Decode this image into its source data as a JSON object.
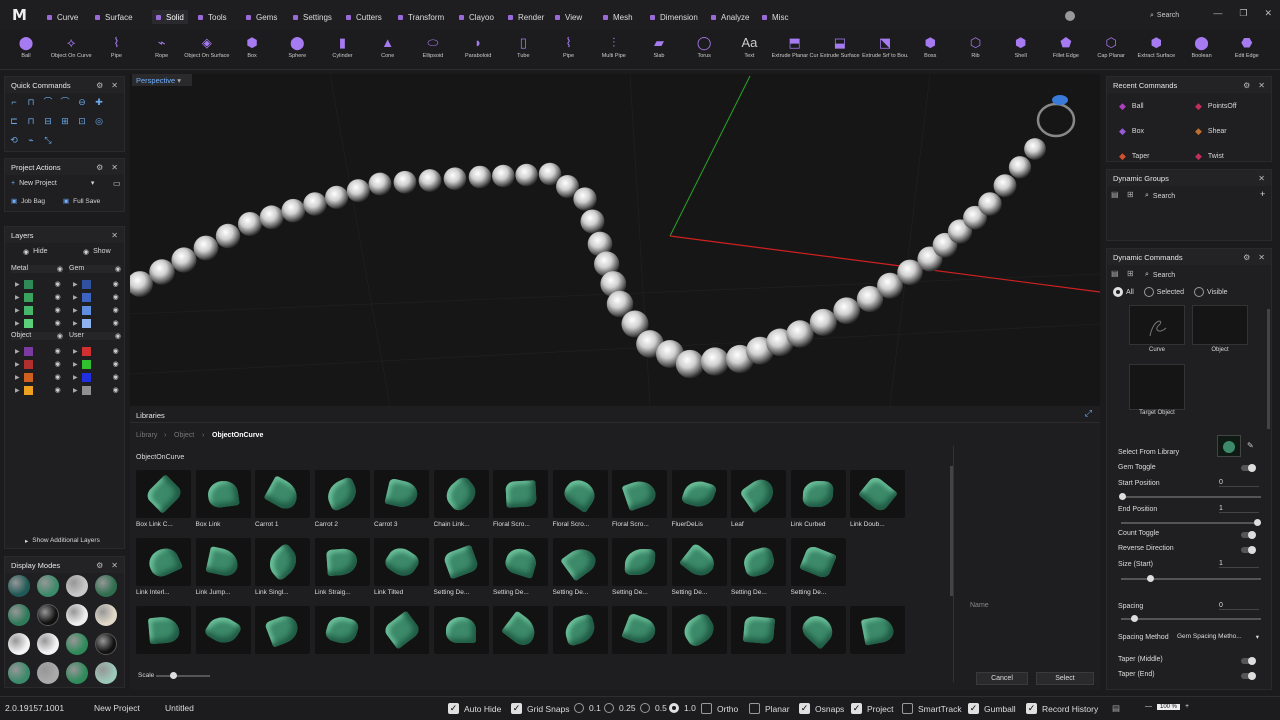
{
  "menu": {
    "tabs": [
      "Curve",
      "Surface",
      "Solid",
      "Tools",
      "Gems",
      "Settings",
      "Cutters",
      "Transform",
      "Clayoo",
      "Render",
      "View",
      "Mesh",
      "Dimension",
      "Analyze",
      "Misc"
    ],
    "active": "Solid",
    "accent": "#9a6ad8",
    "profile_name": "",
    "search_label": "Search"
  },
  "toolbar": {
    "items": [
      "Ball",
      "Object On Curve",
      "Pipe",
      "Rope",
      "Object On Surface",
      "Box",
      "Sphere",
      "Cylinder",
      "Cone",
      "Ellipsoid",
      "Paraboloid",
      "Tube",
      "Pipe",
      "Multi Pipe",
      "Slab",
      "Torus",
      "Text",
      "Extrude Planar Curve",
      "Extrude Surface",
      "Extrude Srf to Bou...",
      "Boss",
      "Rib",
      "Shell",
      "Fillet Edge",
      "Cap Planar",
      "Extract Surface",
      "Boolean",
      "Edit Edge"
    ],
    "text_icon": "Aa"
  },
  "quick_commands": {
    "title": "Quick Commands"
  },
  "project_actions": {
    "title": "Project Actions",
    "new_project": "New Project",
    "job_bag": "Job Bag",
    "full_save": "Full Save"
  },
  "layers": {
    "title": "Layers",
    "hide": "Hide",
    "show": "Show",
    "groups": [
      "Metal",
      "Gem",
      "Object",
      "User"
    ],
    "metal_colors": [
      "#2e8b57",
      "#3aa35e",
      "#46b86a",
      "#5ccf7a"
    ],
    "gem_colors": [
      "#3050a0",
      "#3c64c0",
      "#5f8de0",
      "#8fb3f0"
    ],
    "object_colors": [
      "#7a3aa0",
      "#b03030",
      "#d06020",
      "#f0a020"
    ],
    "user_colors": [
      "#d03030",
      "#30c030",
      "#2030e0",
      "#909090"
    ],
    "show_additional": "Show Additional Layers"
  },
  "display_modes": {
    "title": "Display Modes"
  },
  "viewport": {
    "label": "Perspective"
  },
  "libraries": {
    "title": "Libraries",
    "breadcrumb": [
      "Library",
      "Object",
      "ObjectOnCurve"
    ],
    "section": "ObjectOnCurve",
    "items_row1": [
      "Box Link C...",
      "Box Link",
      "Carrot 1",
      "Carrot 2",
      "Carrot 3",
      "Chain Link...",
      "Floral Scro...",
      "Floral Scro...",
      "Floral Scro...",
      "FluerDeLis",
      "Leaf",
      "Link Curbed",
      "Link Doub..."
    ],
    "items_row2": [
      "Link Interl...",
      "Link Jump...",
      "Link Singl...",
      "Link Straig...",
      "Link Tilted",
      "Setting De...",
      "Setting De...",
      "Setting De...",
      "Setting De...",
      "Setting De...",
      "Setting De...",
      "Setting De..."
    ],
    "items_row3": [
      "",
      "",
      "",
      "",
      "",
      "",
      "",
      "",
      "",
      "",
      "",
      "",
      ""
    ],
    "name_label": "Name",
    "scale_label": "Scale",
    "cancel": "Cancel",
    "select": "Select"
  },
  "recent_commands": {
    "title": "Recent Commands",
    "items": [
      "Ball",
      "PointsOff",
      "Box",
      "Shear",
      "Taper",
      "Twist"
    ]
  },
  "dynamic_groups": {
    "title": "Dynamic Groups",
    "search": "Search"
  },
  "dynamic_commands": {
    "title": "Dynamic Commands",
    "search": "Search",
    "filters": [
      "All",
      "Selected",
      "Visible"
    ],
    "slots": [
      "Curve",
      "Object",
      "Target Object"
    ],
    "select_from_library": "Select From Library",
    "gem_toggle": "Gem Toggle",
    "start_position": "Start Position",
    "start_value": "0",
    "end_position": "End Position",
    "end_value": "1",
    "count_toggle": "Count Toggle",
    "reverse_direction": "Reverse Direction",
    "size_start": "Size (Start)",
    "size_value": "1",
    "spacing": "Spacing",
    "spacing_value": "0",
    "spacing_method": "Spacing Method",
    "spacing_method_value": "Gem Spacing Metho...",
    "taper_middle": "Taper (Middle)",
    "taper_end": "Taper (End)"
  },
  "statusbar": {
    "version": "2.0.19157.1001",
    "new_project": "New Project",
    "untitled": "Untitled",
    "auto_hide": "Auto Hide",
    "grid_snaps": "Grid Snaps",
    "snap_values": [
      "0.1",
      "0.25",
      "0.5",
      "1.0"
    ],
    "ortho": "Ortho",
    "planar": "Planar",
    "osnaps": "Osnaps",
    "project": "Project",
    "smarttrack": "SmartTrack",
    "gumball": "Gumball",
    "record_history": "Record History",
    "zoom": "100 %"
  }
}
